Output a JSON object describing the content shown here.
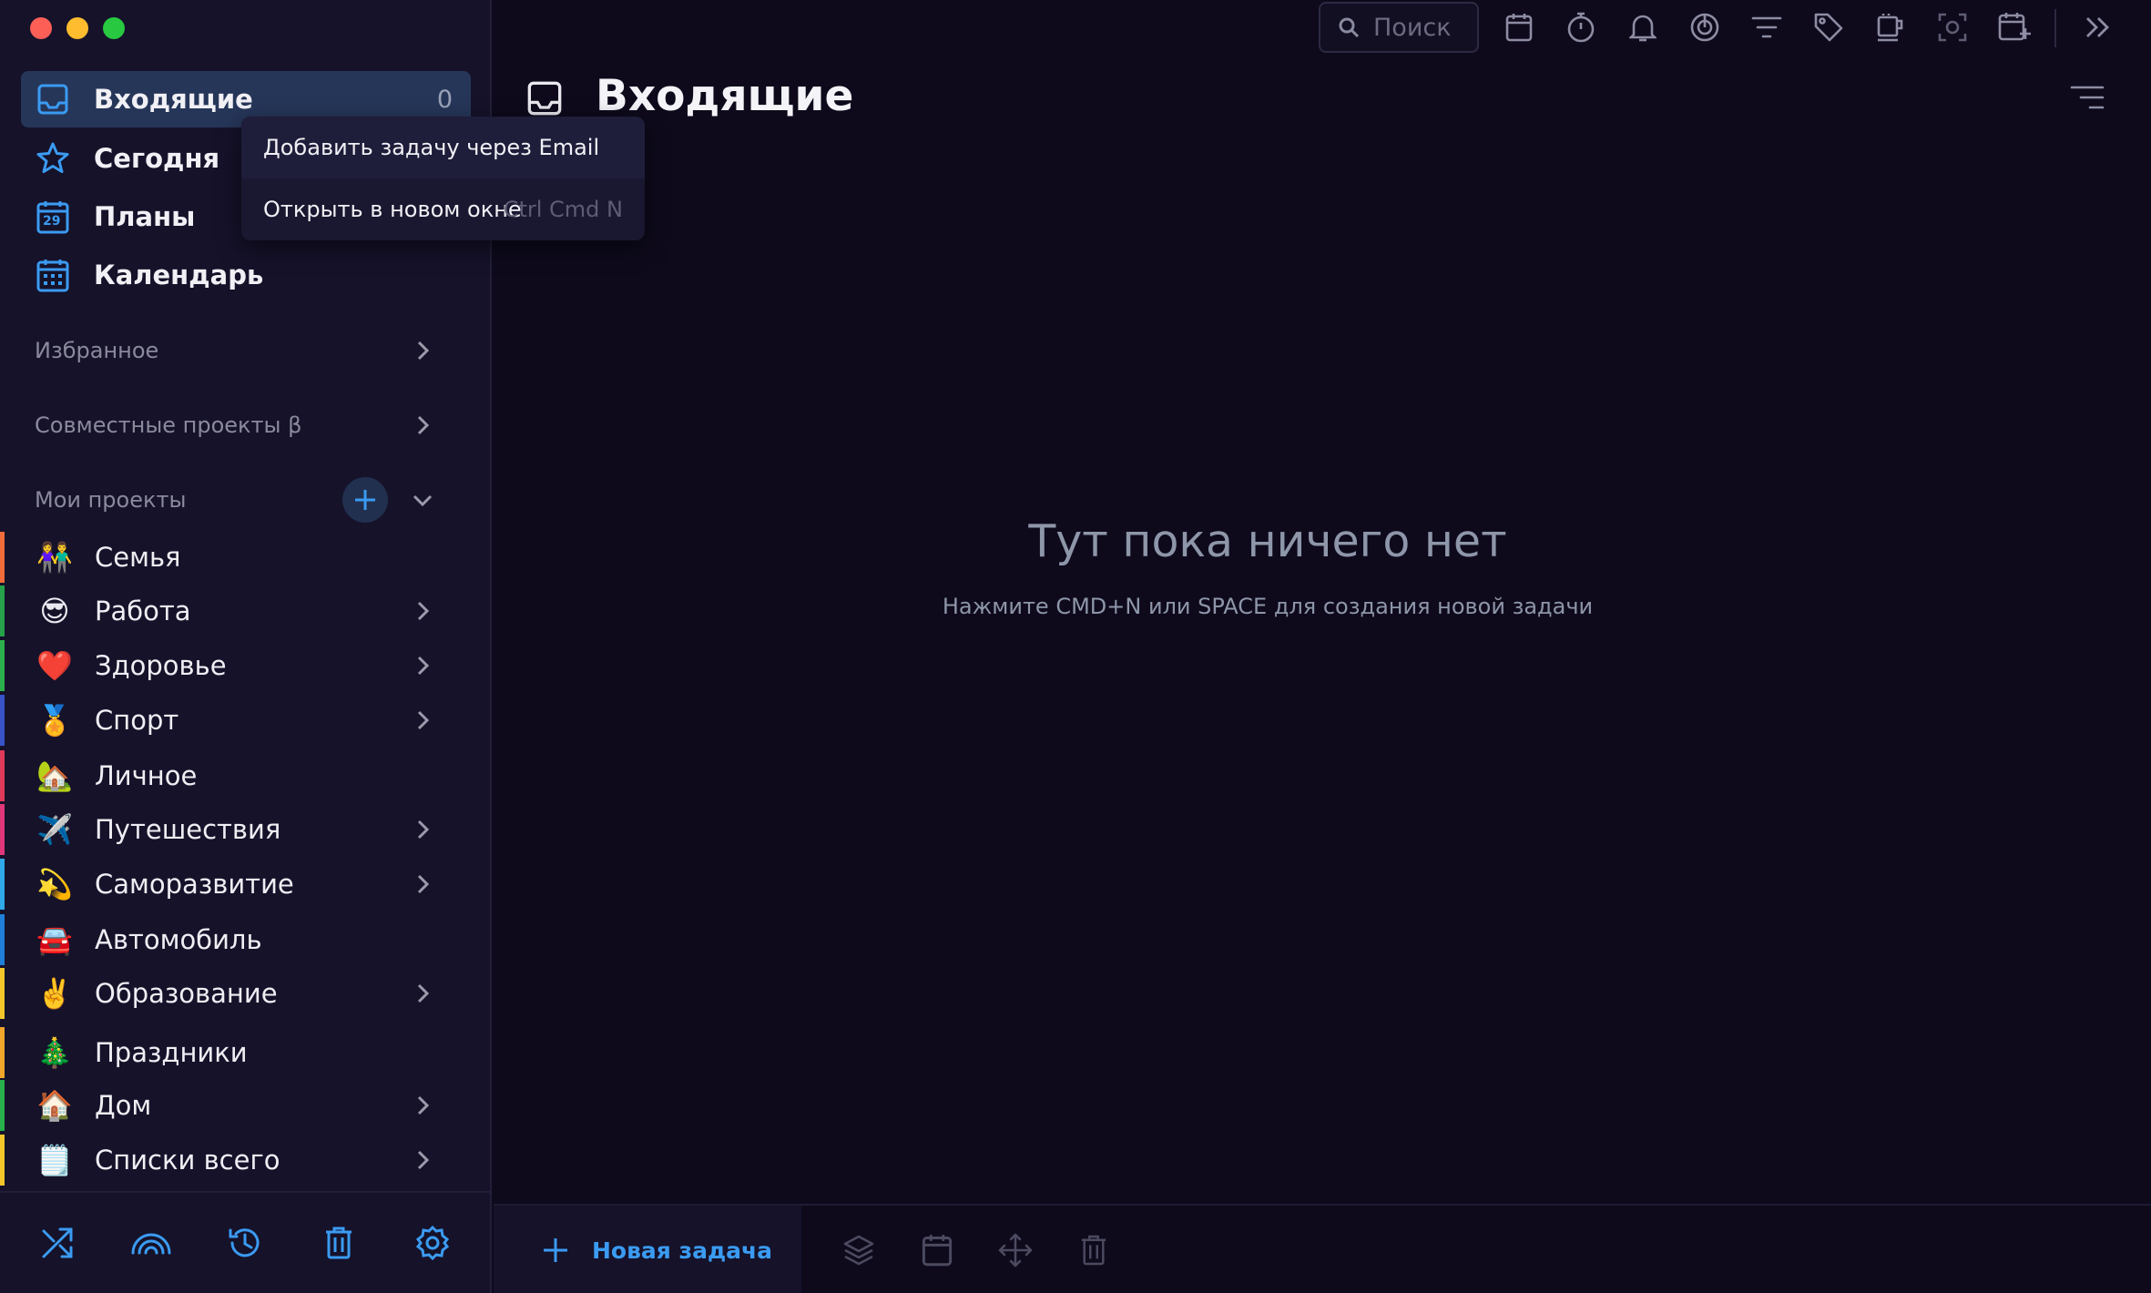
{
  "colors": {
    "accent": "#3b9bf2",
    "sidebar_bg": "#15122a",
    "main_bg": "#0e0a1c",
    "active_bg": "#263659",
    "text_muted": "#8a8a9c"
  },
  "window": {
    "controls": [
      "close",
      "minimize",
      "maximize"
    ]
  },
  "sidebar": {
    "nav": [
      {
        "label": "Входящие",
        "icon": "inbox-icon",
        "count": "0",
        "active": true
      },
      {
        "label": "Сегодня",
        "icon": "star-icon"
      },
      {
        "label": "Планы",
        "icon": "calendar-day-icon",
        "badge": "29"
      },
      {
        "label": "Календарь",
        "icon": "calendar-grid-icon"
      }
    ],
    "sections": {
      "favorites": "Избранное",
      "shared": "Совместные проекты β",
      "my_projects": "Мои проекты"
    },
    "projects": [
      {
        "emoji": "👫",
        "label": "Семья",
        "color": "#f26b3a",
        "has_children": false
      },
      {
        "emoji": "😎",
        "label": "Работа",
        "color": "#25a24a",
        "has_children": true
      },
      {
        "emoji": "❤️",
        "label": "Здоровье",
        "color": "#2bb04b",
        "has_children": true
      },
      {
        "emoji": "🏅",
        "label": "Спорт",
        "color": "#3852c9",
        "has_children": true
      },
      {
        "emoji": "🏡",
        "label": "Личное",
        "color": "#e03a5a",
        "has_children": false
      },
      {
        "emoji": "✈️",
        "label": "Путешествия",
        "color": "#e0367a",
        "has_children": true
      },
      {
        "emoji": "💫",
        "label": "Саморазвитие",
        "color": "#2fa9e8",
        "has_children": true
      },
      {
        "emoji": "🚘",
        "label": "Автомобиль",
        "color": "#1f7fd8",
        "has_children": false
      },
      {
        "emoji": "✌️",
        "label": "Образование",
        "color": "#f3c62c",
        "has_children": true
      },
      {
        "emoji": "🎄",
        "label": "Праздники",
        "color": "#f3a62c",
        "has_children": false
      },
      {
        "emoji": "🏠",
        "label": "Дом",
        "color": "#27b04a",
        "has_children": true
      },
      {
        "emoji": "🗒️",
        "label": "Списки всего",
        "color": "#f3c62c",
        "has_children": true
      }
    ],
    "footer_icons": [
      "shuffle-icon",
      "rainbow-icon",
      "history-icon",
      "trash-icon",
      "settings-icon"
    ]
  },
  "toolbar": {
    "search_placeholder": "Поиск",
    "icons": [
      "calendar-icon",
      "timer-icon",
      "bell-icon",
      "focus-icon",
      "filter-icon",
      "tag-icon",
      "coffee-icon",
      "screenshot-icon",
      "add-calendar-icon",
      "expand-icon"
    ]
  },
  "main": {
    "title": "Входящие",
    "empty_title": "Тут пока ничего нет",
    "empty_subtitle": "Нажмите CMD+N или SPACE для создания новой задачи"
  },
  "bottom_bar": {
    "new_task_label": "Новая задача",
    "icons": [
      "layers-icon",
      "calendar-icon",
      "move-icon",
      "trash-icon"
    ]
  },
  "context_menu": {
    "items": [
      {
        "label": "Добавить задачу через Email",
        "shortcut": ""
      },
      {
        "label": "Открыть в новом окне",
        "shortcut": "Ctrl Cmd N"
      }
    ]
  }
}
